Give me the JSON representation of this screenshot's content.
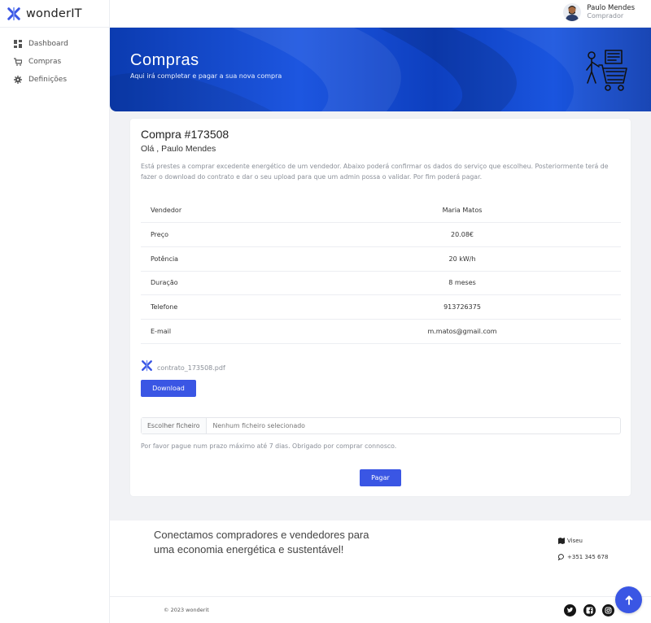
{
  "brand": {
    "name": "wonderIT"
  },
  "sidebar": {
    "items": [
      {
        "label": "Dashboard",
        "icon": "grid-icon"
      },
      {
        "label": "Compras",
        "icon": "cart-icon"
      },
      {
        "label": "Definições",
        "icon": "gear-icon"
      }
    ]
  },
  "user": {
    "name": "Paulo Mendes",
    "role": "Comprador"
  },
  "banner": {
    "title": "Compras",
    "subtitle": "Aqui irá completar e pagar a sua nova compra"
  },
  "purchase": {
    "title": "Compra #173508",
    "greeting": "Olá , Paulo Mendes",
    "description": "Está prestes a comprar excedente energético de um vendedor. Abaixo poderá confirmar os dados do serviço que escolheu. Posteriormente terá de fazer o download do contrato e dar o seu upload para que um admin possa o validar. Por fim poderá pagar.",
    "details": [
      {
        "label": "Vendedor",
        "value": "Maria Matos"
      },
      {
        "label": "Preço",
        "value": "20.08€"
      },
      {
        "label": "Potência",
        "value": "20 kW/h"
      },
      {
        "label": "Duração",
        "value": "8 meses"
      },
      {
        "label": "Telefone",
        "value": "913726375"
      },
      {
        "label": "E-mail",
        "value": "m.matos@gmail.com"
      }
    ],
    "file_name": "contrato_173508.pdf",
    "download_label": "Download",
    "choose_file_label": "Escolher ficheiro",
    "no_file_label": "Nenhum ficheiro selecionado",
    "notice": "Por favor pague num prazo máximo até 7 dias. Obrigado por comprar connosco.",
    "pay_label": "Pagar"
  },
  "footer": {
    "tagline": "Conectamos compradores e vendedores para uma economia energética e sustentável!",
    "location": "Viseu",
    "phone": "+351 345 678",
    "copyright": "© 2023 wonderit"
  },
  "colors": {
    "accent": "#3a56e4",
    "banner": "#1d56e0"
  }
}
